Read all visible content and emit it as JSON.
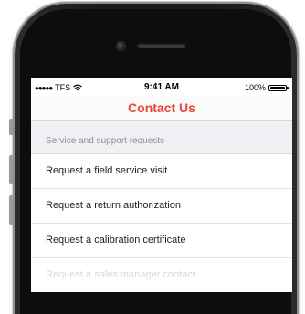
{
  "status_bar": {
    "signal_dots": "●●●●●",
    "carrier": "TFS",
    "wifi_icon": "wifi-icon",
    "time": "9:41 AM",
    "battery_percent": "100%",
    "battery_level": 1.0
  },
  "nav": {
    "title": "Contact Us"
  },
  "section": {
    "header": "Service and support requests",
    "items": [
      {
        "label": "Request a field service visit"
      },
      {
        "label": "Request a return authorization"
      },
      {
        "label": "Request a calibration certificate"
      },
      {
        "label": "Request a sales manager contact"
      }
    ]
  },
  "colors": {
    "accent": "#e8473a",
    "section_bg": "#efeff4",
    "section_text": "#8e8e93"
  }
}
